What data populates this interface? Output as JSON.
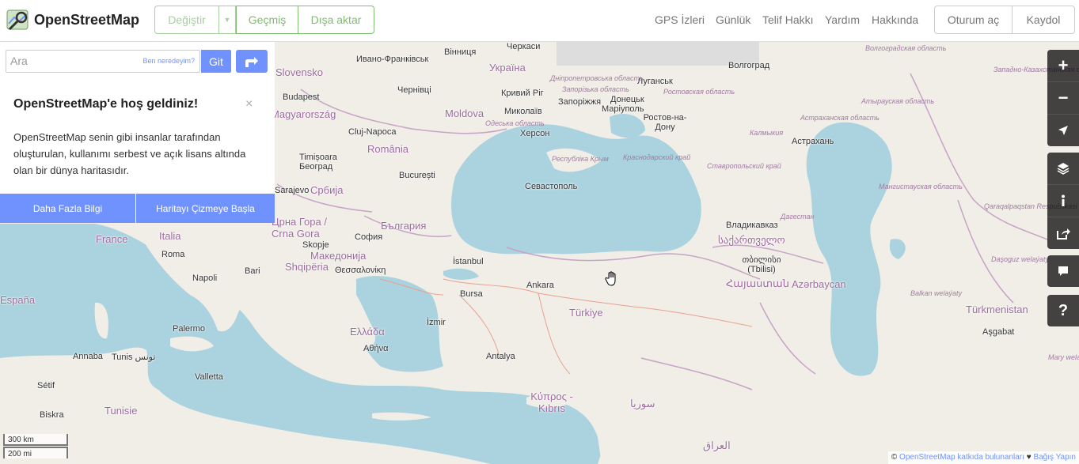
{
  "header": {
    "logo_text": "OpenStreetMap",
    "edit_label": "Değiştir",
    "history_label": "Geçmiş",
    "export_label": "Dışa aktar",
    "nav": [
      "GPS İzleri",
      "Günlük",
      "Telif Hakkı",
      "Yardım",
      "Hakkında"
    ],
    "login_label": "Oturum aç",
    "signup_label": "Kaydol"
  },
  "search": {
    "placeholder": "Ara",
    "where_am_i": "Ben neredeyim?",
    "go_label": "Git"
  },
  "welcome": {
    "title": "OpenStreetMap'e hoş geldiniz!",
    "close": "×",
    "text": "OpenStreetMap senin gibi insanlar tarafından oluşturulan, kullanımı serbest ve açık lisans altında olan bir dünya haritasıdır.",
    "learn_more": "Daha Fazla Bilgi",
    "start_mapping": "Haritayı Çizmeye Başla"
  },
  "map": {
    "countries": [
      "Україна",
      "Moldova",
      "România",
      "Србија",
      "България",
      "Црна Гора / Crna Gora",
      "Shqipëria",
      "Македонија",
      "Ελλάδα",
      "Türkiye",
      "Κύπρος - Kıbrıs",
      "Italia",
      "France",
      "Tunisie",
      "Azərbaycan",
      "Türkmenistan",
      "საქართველო",
      "Հայաստան",
      "Slovensko",
      "Magyarország",
      "España",
      "سوريا",
      "العراق"
    ],
    "cities": [
      "Ивано-Франківськ",
      "Вінниця",
      "Черкаси",
      "Луганськ",
      "Волгоград",
      "Кривий Ріг",
      "Запоріжжя",
      "Донецьк",
      "Маріуполь",
      "Ростов-на-Дону",
      "Миколаїв",
      "Херсон",
      "Чернівці",
      "Budapest",
      "Cluj-Napoca",
      "Timișoara",
      "Београд",
      "București",
      "Севастополь",
      "Астрахань",
      "Владикавказ",
      "თბილისი (Tbilisi)",
      "София",
      "Skopje",
      "Θεσσαλονίκη",
      "İstanbul",
      "Ankara",
      "Bursa",
      "İzmir",
      "Antalya",
      "Αθήνα",
      "Roma",
      "Napoli",
      "Bari",
      "Palermo",
      "Valletta",
      "Annaba",
      "Tunis تونس",
      "Sétif",
      "Biskra",
      "Sarajevo",
      "Aşgabat"
    ],
    "regions": [
      "Дніпропетровська область",
      "Ростовская область",
      "Запорізька область",
      "Одеська область",
      "Республіка Крым",
      "Краснодарский край",
      "Ставропольский край",
      "Калмыкия",
      "Астраханская область",
      "Атырауская область",
      "Волгоградская область",
      "Мангистауская область",
      "Qaraqalpaqstan Respublikasi",
      "Daşoguz welaýaty",
      "Balkan welaýaty",
      "Дагестан",
      "Mary wela",
      "Западно-Казахстанская область"
    ],
    "scale_km": "300 km",
    "scale_mi": "200 mi"
  },
  "controls": {
    "zoom_in": "+",
    "zoom_out": "−",
    "query": "?"
  },
  "attribution": {
    "copyright": "©",
    "osm_link": "OpenStreetMap katkıda bulunanları",
    "heart": "♥",
    "donate": "Bağış Yapın"
  },
  "colors": {
    "accent": "#7ebc6f",
    "link": "#7092ff",
    "water": "#aad3df",
    "land": "#f1eee8"
  }
}
